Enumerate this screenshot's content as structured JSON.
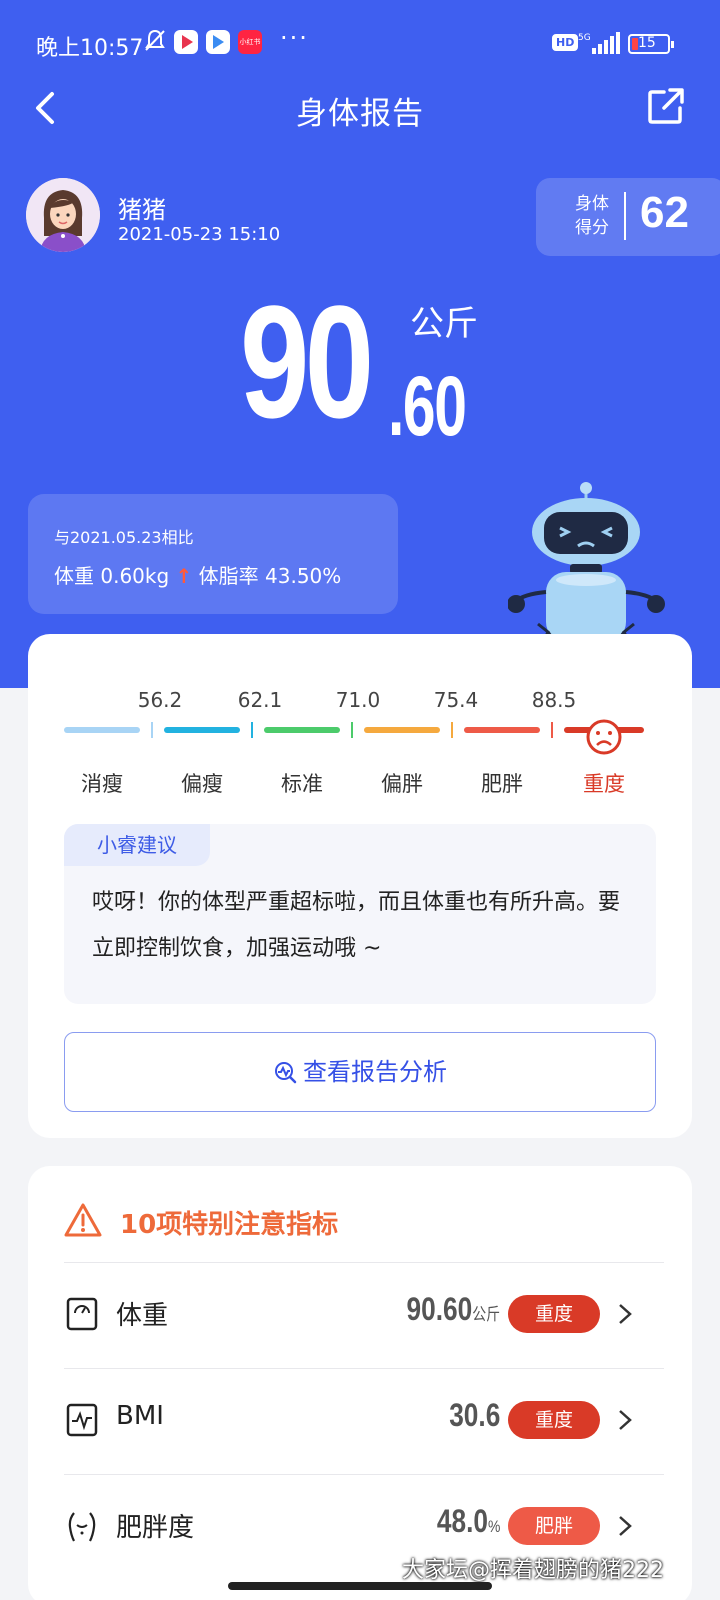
{
  "status_bar": {
    "time": "晚上10:57",
    "app_icon_label": "小红书",
    "network": "5G",
    "hd": "HD",
    "battery": "15"
  },
  "header": {
    "title": "身体报告"
  },
  "user": {
    "name": "猪猪",
    "datetime": "2021-05-23 15:10"
  },
  "score": {
    "label_line1": "身体",
    "label_line2": "得分",
    "value": "62"
  },
  "weight": {
    "integer": "90",
    "decimal": ".60",
    "unit": "公斤"
  },
  "comparison": {
    "date_text": "与2021.05.23相比",
    "weight_label": "体重",
    "weight_change": "0.60kg",
    "fat_label": "体脂率",
    "fat_value": "43.50%"
  },
  "scale": {
    "thresholds": [
      "56.2",
      "62.1",
      "71.0",
      "75.4",
      "88.5"
    ],
    "categories": [
      "消瘦",
      "偏瘦",
      "标准",
      "偏胖",
      "肥胖",
      "重度"
    ],
    "colors": [
      "#a8d4f5",
      "#22b2e0",
      "#4ccb6b",
      "#f5a93e",
      "#ee5a47",
      "#d93a27"
    ],
    "active_index": 5
  },
  "advice": {
    "tag": "小睿建议",
    "text": "哎呀！你的体型严重超标啦，而且体重也有所升高。要立即控制饮食，加强运动哦 ~"
  },
  "report_button": {
    "label": "查看报告分析"
  },
  "attention": {
    "title": "10项特别注意指标",
    "items": [
      {
        "name": "体重",
        "value": "90.60",
        "unit": "公斤",
        "badge": "重度",
        "badge_color": "#d93a27",
        "icon": "scale-icon"
      },
      {
        "name": "BMI",
        "value": "30.6",
        "unit": "",
        "badge": "重度",
        "badge_color": "#d93a27",
        "icon": "pulse-icon"
      },
      {
        "name": "肥胖度",
        "value": "48.0",
        "unit": "%",
        "badge": "肥胖",
        "badge_color": "#ee5a47",
        "icon": "body-icon"
      }
    ]
  },
  "watermark": "大家坛@挥着翅膀的猪222"
}
